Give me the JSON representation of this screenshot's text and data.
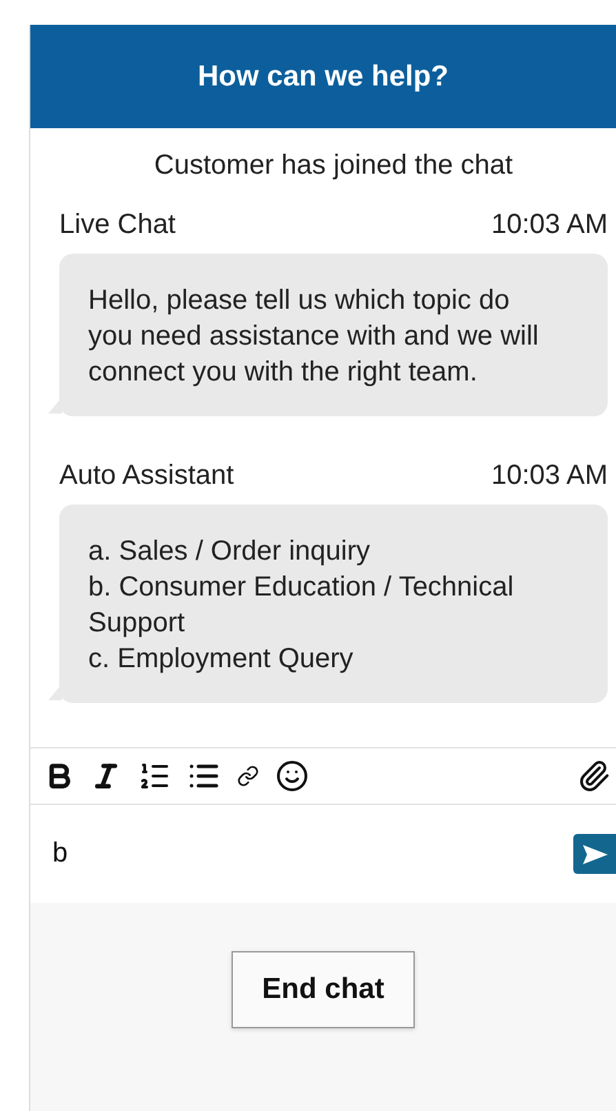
{
  "header": {
    "title": "How can we help?"
  },
  "system_message": "Customer has joined the chat",
  "messages": [
    {
      "sender": "Live Chat",
      "time": "10:03 AM",
      "lines": [
        "Hello, please tell us which topic do you need assistance with and we will connect you with the right team."
      ]
    },
    {
      "sender": "Auto Assistant",
      "time": "10:03 AM",
      "lines": [
        "a. Sales / Order inquiry",
        "b. Consumer Education / Technical Support",
        "c. Employment Query"
      ]
    }
  ],
  "composer": {
    "value": "b"
  },
  "footer": {
    "button": "End chat"
  }
}
